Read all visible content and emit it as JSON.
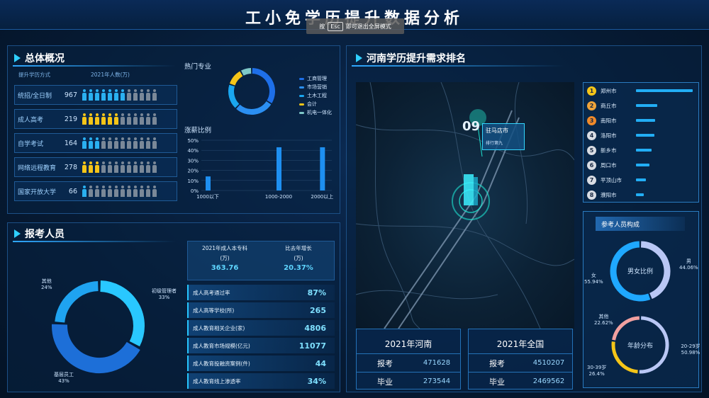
{
  "header": {
    "title": "工小免学历提升数据分析",
    "esc_prefix": "按",
    "esc_key": "Esc",
    "esc_suffix": "即可退出全屏模式"
  },
  "overview": {
    "title": "总体概况",
    "col1": "提升学历方式",
    "col2": "2021年人数(万)",
    "rows": [
      {
        "name": "统招/全日制",
        "value": "967",
        "filled": 7,
        "color": "#2ab0f0"
      },
      {
        "name": "成人高考",
        "value": "219",
        "filled": 6,
        "color": "#f5c518"
      },
      {
        "name": "自学考试",
        "value": "164",
        "filled": 3,
        "color": "#2ab0f0"
      },
      {
        "name": "网络远程教育",
        "value": "278",
        "filled": 3,
        "color": "#f5c518"
      },
      {
        "name": "国家开放大学",
        "value": "66",
        "filled": 1,
        "color": "#2ab0f0"
      }
    ]
  },
  "hot_major": {
    "title": "热门专业",
    "legend": [
      {
        "label": "工商管理",
        "color": "#1e6fe8"
      },
      {
        "label": "市场营销",
        "color": "#2b8ff2"
      },
      {
        "label": "土木工程",
        "color": "#1aa7f0"
      },
      {
        "label": "会计",
        "color": "#f5c518"
      },
      {
        "label": "机电一体化",
        "color": "#7ec8c8"
      }
    ]
  },
  "growth": {
    "title": "涨薪比例",
    "y_ticks": [
      "50%",
      "40%",
      "30%",
      "20%",
      "10%",
      "0%"
    ],
    "chart_data": {
      "type": "bar",
      "categories": [
        "1000以下",
        "1000-2000",
        "2000以上"
      ],
      "values": [
        14,
        43,
        43
      ],
      "ylim": [
        0,
        50
      ]
    }
  },
  "applicants": {
    "title": "报考人员",
    "donut": [
      {
        "label": "初级管理者",
        "pct": "33%",
        "value": 33
      },
      {
        "label": "基层员工",
        "pct": "43%",
        "value": 43
      },
      {
        "label": "其他",
        "pct": "24%",
        "value": 24
      }
    ],
    "summary": {
      "h1": "2021年成人本专科",
      "h1b": "(万)",
      "v1": "363.76",
      "h2": "比去年增长",
      "h2b": "(万)",
      "v2": "20.37%"
    },
    "stats": [
      {
        "label": "成人高考通过率",
        "value": "87%"
      },
      {
        "label": "成人高等学校(所)",
        "value": "265"
      },
      {
        "label": "成人教育相关企业(家)",
        "value": "4806"
      },
      {
        "label": "成人教育市场规模(亿元)",
        "value": "11077"
      },
      {
        "label": "成人教育投融资案例(件)",
        "value": "44"
      },
      {
        "label": "成人教育线上渗透率",
        "value": "34%"
      }
    ]
  },
  "henan": {
    "title": "河南学历提升需求排名",
    "map": {
      "badge_num": "09",
      "badge_city": "驻马店市",
      "badge_sub": "排行第九"
    },
    "ranking": [
      {
        "rank": "1",
        "city": "郑州市",
        "value": 100,
        "color": "#f5c518"
      },
      {
        "rank": "2",
        "city": "商丘市",
        "value": 38,
        "color": "#f0a43a"
      },
      {
        "rank": "3",
        "city": "南阳市",
        "value": 34,
        "color": "#f08a2a"
      },
      {
        "rank": "4",
        "city": "洛阳市",
        "value": 32,
        "color": "#d9dde4"
      },
      {
        "rank": "5",
        "city": "新乡市",
        "value": 28,
        "color": "#d9dde4"
      },
      {
        "rank": "6",
        "city": "周口市",
        "value": 24,
        "color": "#d9dde4"
      },
      {
        "rank": "7",
        "city": "平顶山市",
        "value": 18,
        "color": "#d9dde4"
      },
      {
        "rank": "8",
        "city": "濮阳市",
        "value": 14,
        "color": "#d9dde4"
      }
    ],
    "box_henan": {
      "title": "2021年河南",
      "k1": "报考",
      "v1": "471628",
      "k2": "毕业",
      "v2": "273544"
    },
    "box_national": {
      "title": "2021年全国",
      "k1": "报考",
      "v1": "4510207",
      "k2": "毕业",
      "v2": "2469562"
    }
  },
  "composition": {
    "title": "参考人员构成",
    "gender": {
      "center": "男女比例",
      "male_label": "男",
      "male_pct": "44.06%",
      "female_label": "女",
      "female_pct": "55.94%",
      "male": 44.06,
      "female": 55.94
    },
    "age": {
      "center": "年龄分布",
      "a_label": "20-29岁",
      "a_pct": "50.98%",
      "b_label": "30-39岁",
      "b_pct": "26.4%",
      "c_label": "其他",
      "c_pct": "22.62%",
      "a": 50.98,
      "b": 26.4,
      "c": 22.62
    }
  }
}
